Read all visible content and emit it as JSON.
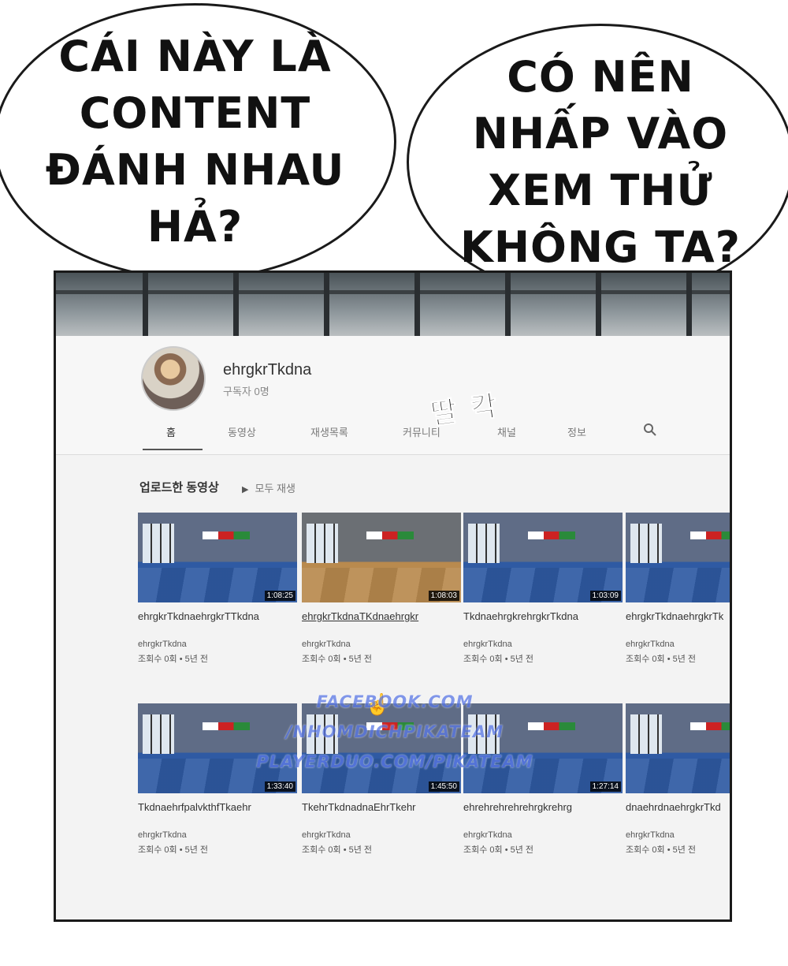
{
  "bubbles": {
    "left": [
      "CÁI NÀY LÀ",
      "CONTENT",
      "ĐÁNH NHAU",
      "HẢ?"
    ],
    "right": [
      "CÓ NÊN",
      "NHẤP VÀO",
      "XEM THỬ",
      "KHÔNG TA?"
    ]
  },
  "channel": {
    "name": "ehrgkrTkdna",
    "subscribers": "구독자 0명",
    "tabs": [
      "홈",
      "동영상",
      "재생목록",
      "커뮤니티",
      "채널",
      "정보"
    ],
    "search_icon": "search-icon"
  },
  "sfx": "딸 칵",
  "section": {
    "title": "업로드한 동영상",
    "play_all": "모두 재생"
  },
  "videos": [
    {
      "title": "ehrgkrTkdnaehrgkrTTkdna",
      "duration": "1:08:25",
      "channel": "ehrgkrTkdna",
      "meta": "조회수 0회 • 5년 전"
    },
    {
      "title": "ehrgkrTkdnaTKdnaehrgkr",
      "duration": "1:08:03",
      "channel": "ehrgkrTkdna",
      "meta": "조회수 0회 • 5년 전"
    },
    {
      "title": "TkdnaehrgkrehrgkrTkdna",
      "duration": "1:03:09",
      "channel": "ehrgkrTkdna",
      "meta": "조회수 0회 • 5년 전"
    },
    {
      "title": "ehrgkrTkdnaehrgkrTk",
      "duration": "",
      "channel": "ehrgkrTkdna",
      "meta": "조회수 0회 • 5년 전"
    },
    {
      "title": "TkdnaehrfpalvkthfTkaehr",
      "duration": "1:33:40",
      "channel": "ehrgkrTkdna",
      "meta": "조회수 0회 • 5년 전"
    },
    {
      "title": "TkehrTkdnadnaEhrTkehr",
      "duration": "1:45:50",
      "channel": "ehrgkrTkdna",
      "meta": "조회수 0회 • 5년 전"
    },
    {
      "title": "ehrehrehrehrehrgkrehrg",
      "duration": "1:27:14",
      "channel": "ehrgkrTkdna",
      "meta": "조회수 0회 • 5년 전"
    },
    {
      "title": "dnaehrdnaehrgkrTkd",
      "duration": "",
      "channel": "ehrgkrTkdna",
      "meta": "조회수 0회 • 5년 전"
    }
  ],
  "watermark": [
    "FACEBOOK.COM",
    "/NHOMDICHPIKATEAM",
    "PLAYERDUO.COM/PIKATEAM"
  ],
  "colors": {
    "watermark": "#5a78e6",
    "video_floor": "#2f5aa3",
    "duration_bg": "#000000"
  }
}
